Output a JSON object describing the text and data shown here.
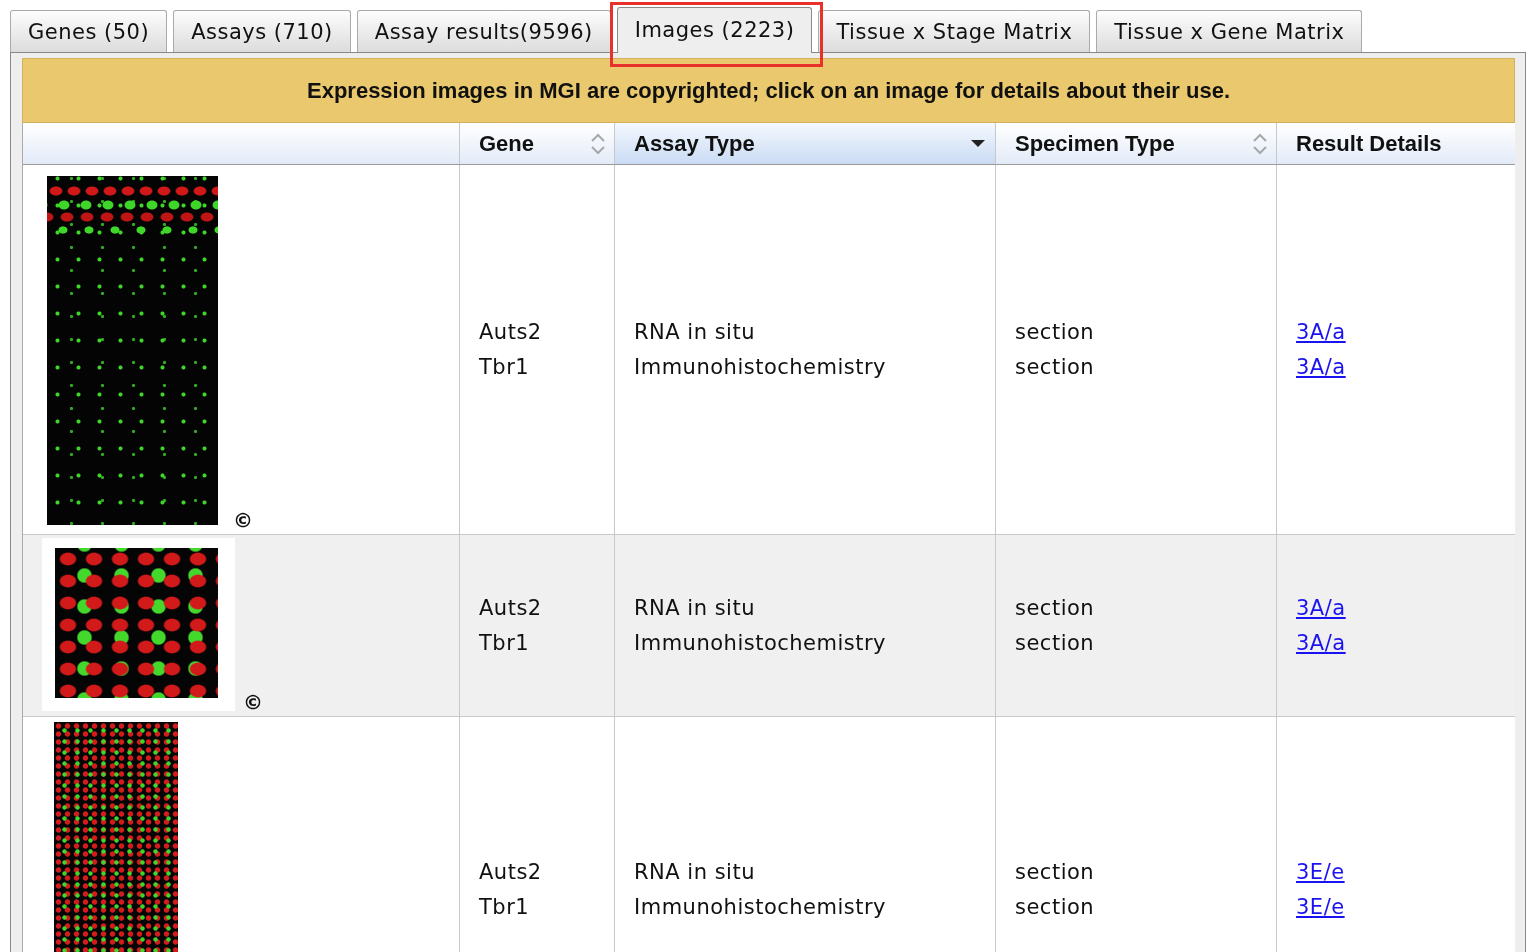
{
  "tabs": [
    {
      "label": "Genes (50)",
      "selected": false,
      "highlighted": false
    },
    {
      "label": "Assays (710)",
      "selected": false,
      "highlighted": false
    },
    {
      "label": "Assay results(9596)",
      "selected": false,
      "highlighted": false
    },
    {
      "label": "Images (2223)",
      "selected": true,
      "highlighted": true
    },
    {
      "label": "Tissue x Stage Matrix",
      "selected": false,
      "highlighted": false
    },
    {
      "label": "Tissue x Gene Matrix",
      "selected": false,
      "highlighted": false
    }
  ],
  "notice": "Expression images in MGI are copyrighted; click on an image for details about their use.",
  "table": {
    "columns": [
      {
        "label": "Gene",
        "sortable": true,
        "sorted": false
      },
      {
        "label": "Assay Type",
        "sortable": true,
        "sorted": true
      },
      {
        "label": "Specimen Type",
        "sortable": true,
        "sorted": false
      },
      {
        "label": "Result Details",
        "sortable": false,
        "sorted": false
      }
    ],
    "rows": [
      {
        "image": {
          "framed": false,
          "copyright": "©"
        },
        "genes": [
          "Auts2",
          "Tbr1"
        ],
        "assay_types": [
          "RNA in situ",
          "Immunohistochemistry"
        ],
        "specimen_types": [
          "section",
          "section"
        ],
        "result_details": [
          "3A/a",
          "3A/a"
        ]
      },
      {
        "image": {
          "framed": true,
          "copyright": "©"
        },
        "genes": [
          "Auts2",
          "Tbr1"
        ],
        "assay_types": [
          "RNA in situ",
          "Immunohistochemistry"
        ],
        "specimen_types": [
          "section",
          "section"
        ],
        "result_details": [
          "3A/a",
          "3A/a"
        ]
      },
      {
        "image": {
          "framed": false
        },
        "genes": [
          "Auts2",
          "Tbr1"
        ],
        "assay_types": [
          "RNA in situ",
          "Immunohistochemistry"
        ],
        "specimen_types": [
          "section",
          "section"
        ],
        "result_details": [
          "3E/e",
          "3E/e"
        ]
      }
    ]
  }
}
